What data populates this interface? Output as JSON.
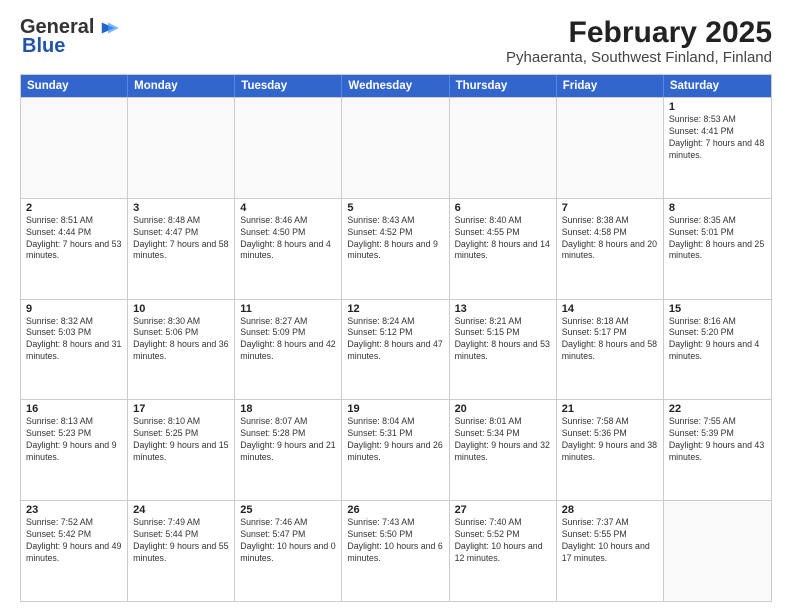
{
  "logo": {
    "line1": "General",
    "line2": "Blue"
  },
  "title": "February 2025",
  "subtitle": "Pyhaeranta, Southwest Finland, Finland",
  "days_of_week": [
    "Sunday",
    "Monday",
    "Tuesday",
    "Wednesday",
    "Thursday",
    "Friday",
    "Saturday"
  ],
  "weeks": [
    [
      {
        "day": "",
        "info": "",
        "empty": true
      },
      {
        "day": "",
        "info": "",
        "empty": true
      },
      {
        "day": "",
        "info": "",
        "empty": true
      },
      {
        "day": "",
        "info": "",
        "empty": true
      },
      {
        "day": "",
        "info": "",
        "empty": true
      },
      {
        "day": "",
        "info": "",
        "empty": true
      },
      {
        "day": "1",
        "info": "Sunrise: 8:53 AM\nSunset: 4:41 PM\nDaylight: 7 hours and 48 minutes.",
        "empty": false
      }
    ],
    [
      {
        "day": "2",
        "info": "Sunrise: 8:51 AM\nSunset: 4:44 PM\nDaylight: 7 hours and 53 minutes.",
        "empty": false
      },
      {
        "day": "3",
        "info": "Sunrise: 8:48 AM\nSunset: 4:47 PM\nDaylight: 7 hours and 58 minutes.",
        "empty": false
      },
      {
        "day": "4",
        "info": "Sunrise: 8:46 AM\nSunset: 4:50 PM\nDaylight: 8 hours and 4 minutes.",
        "empty": false
      },
      {
        "day": "5",
        "info": "Sunrise: 8:43 AM\nSunset: 4:52 PM\nDaylight: 8 hours and 9 minutes.",
        "empty": false
      },
      {
        "day": "6",
        "info": "Sunrise: 8:40 AM\nSunset: 4:55 PM\nDaylight: 8 hours and 14 minutes.",
        "empty": false
      },
      {
        "day": "7",
        "info": "Sunrise: 8:38 AM\nSunset: 4:58 PM\nDaylight: 8 hours and 20 minutes.",
        "empty": false
      },
      {
        "day": "8",
        "info": "Sunrise: 8:35 AM\nSunset: 5:01 PM\nDaylight: 8 hours and 25 minutes.",
        "empty": false
      }
    ],
    [
      {
        "day": "9",
        "info": "Sunrise: 8:32 AM\nSunset: 5:03 PM\nDaylight: 8 hours and 31 minutes.",
        "empty": false
      },
      {
        "day": "10",
        "info": "Sunrise: 8:30 AM\nSunset: 5:06 PM\nDaylight: 8 hours and 36 minutes.",
        "empty": false
      },
      {
        "day": "11",
        "info": "Sunrise: 8:27 AM\nSunset: 5:09 PM\nDaylight: 8 hours and 42 minutes.",
        "empty": false
      },
      {
        "day": "12",
        "info": "Sunrise: 8:24 AM\nSunset: 5:12 PM\nDaylight: 8 hours and 47 minutes.",
        "empty": false
      },
      {
        "day": "13",
        "info": "Sunrise: 8:21 AM\nSunset: 5:15 PM\nDaylight: 8 hours and 53 minutes.",
        "empty": false
      },
      {
        "day": "14",
        "info": "Sunrise: 8:18 AM\nSunset: 5:17 PM\nDaylight: 8 hours and 58 minutes.",
        "empty": false
      },
      {
        "day": "15",
        "info": "Sunrise: 8:16 AM\nSunset: 5:20 PM\nDaylight: 9 hours and 4 minutes.",
        "empty": false
      }
    ],
    [
      {
        "day": "16",
        "info": "Sunrise: 8:13 AM\nSunset: 5:23 PM\nDaylight: 9 hours and 9 minutes.",
        "empty": false
      },
      {
        "day": "17",
        "info": "Sunrise: 8:10 AM\nSunset: 5:25 PM\nDaylight: 9 hours and 15 minutes.",
        "empty": false
      },
      {
        "day": "18",
        "info": "Sunrise: 8:07 AM\nSunset: 5:28 PM\nDaylight: 9 hours and 21 minutes.",
        "empty": false
      },
      {
        "day": "19",
        "info": "Sunrise: 8:04 AM\nSunset: 5:31 PM\nDaylight: 9 hours and 26 minutes.",
        "empty": false
      },
      {
        "day": "20",
        "info": "Sunrise: 8:01 AM\nSunset: 5:34 PM\nDaylight: 9 hours and 32 minutes.",
        "empty": false
      },
      {
        "day": "21",
        "info": "Sunrise: 7:58 AM\nSunset: 5:36 PM\nDaylight: 9 hours and 38 minutes.",
        "empty": false
      },
      {
        "day": "22",
        "info": "Sunrise: 7:55 AM\nSunset: 5:39 PM\nDaylight: 9 hours and 43 minutes.",
        "empty": false
      }
    ],
    [
      {
        "day": "23",
        "info": "Sunrise: 7:52 AM\nSunset: 5:42 PM\nDaylight: 9 hours and 49 minutes.",
        "empty": false
      },
      {
        "day": "24",
        "info": "Sunrise: 7:49 AM\nSunset: 5:44 PM\nDaylight: 9 hours and 55 minutes.",
        "empty": false
      },
      {
        "day": "25",
        "info": "Sunrise: 7:46 AM\nSunset: 5:47 PM\nDaylight: 10 hours and 0 minutes.",
        "empty": false
      },
      {
        "day": "26",
        "info": "Sunrise: 7:43 AM\nSunset: 5:50 PM\nDaylight: 10 hours and 6 minutes.",
        "empty": false
      },
      {
        "day": "27",
        "info": "Sunrise: 7:40 AM\nSunset: 5:52 PM\nDaylight: 10 hours and 12 minutes.",
        "empty": false
      },
      {
        "day": "28",
        "info": "Sunrise: 7:37 AM\nSunset: 5:55 PM\nDaylight: 10 hours and 17 minutes.",
        "empty": false
      },
      {
        "day": "",
        "info": "",
        "empty": true
      }
    ]
  ]
}
